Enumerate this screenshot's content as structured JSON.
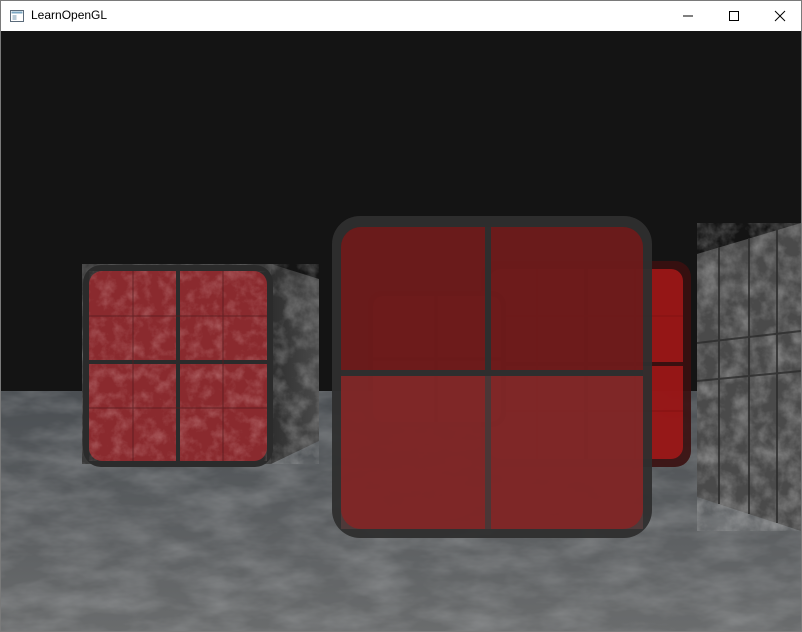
{
  "window": {
    "title": "LearnOpenGL"
  },
  "icons": {
    "app": "window-app-icon",
    "minimize": "minimize-icon",
    "maximize": "maximize-icon",
    "close": "close-icon"
  },
  "colors": {
    "clear_color": "#141414",
    "floor": "#5a5a5a",
    "window_glass": "#c41616",
    "window_frame": "#2b2b2b",
    "marble": "#3c3c3c"
  }
}
